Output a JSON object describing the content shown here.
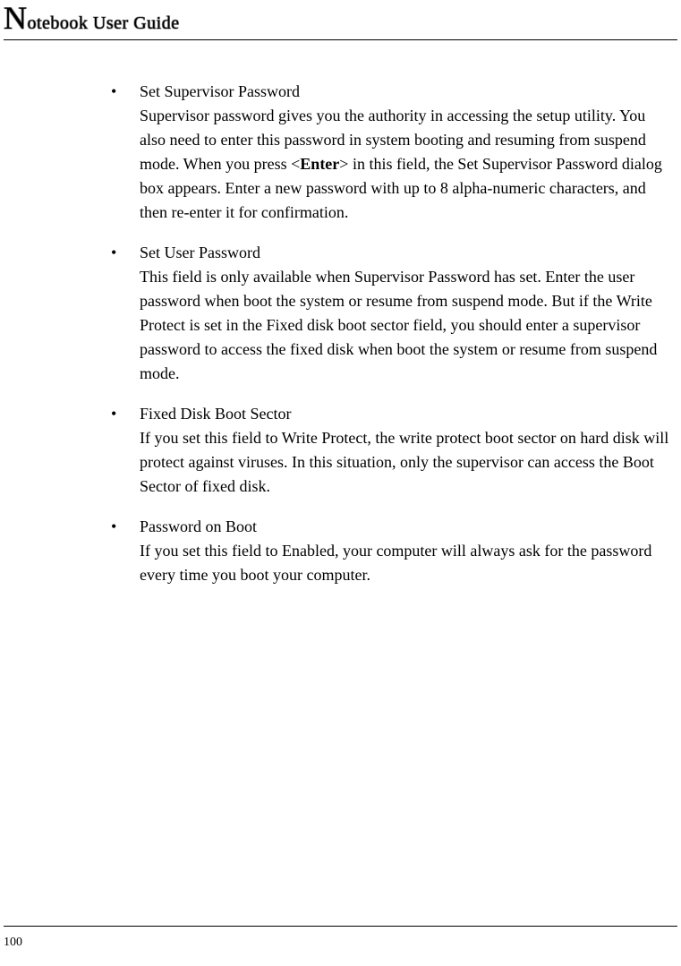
{
  "header": {
    "title_rest": "otebook User Guide"
  },
  "items": [
    {
      "title": "Set Supervisor Password",
      "body_pre": "Supervisor password gives you the authority in accessing the setup utility. You also need to enter this password in system booting and resuming from suspend mode. When you press <",
      "key": "Enter",
      "body_post": "> in this field, the Set Supervisor Password dialog box appears. Enter a new password with up to 8 alpha-numeric characters, and then re-enter it for confirmation."
    },
    {
      "title": "Set User Password",
      "body": "This field is only available when Supervisor Password has set. Enter the user password when boot the system or resume from suspend mode. But if the Write Protect is set in the Fixed disk boot sector field, you should enter a supervisor password to access the fixed disk when boot the system or resume from suspend mode."
    },
    {
      "title": "Fixed Disk Boot Sector",
      "body": "If you set this field to Write Protect, the write protect boot sector on hard disk will protect against viruses. In this situation, only the supervisor can access the Boot Sector of fixed disk."
    },
    {
      "title": "Password on Boot",
      "body": "If you set this field to Enabled, your computer will always ask for the password every time you boot your computer."
    }
  ],
  "page_number": "100"
}
